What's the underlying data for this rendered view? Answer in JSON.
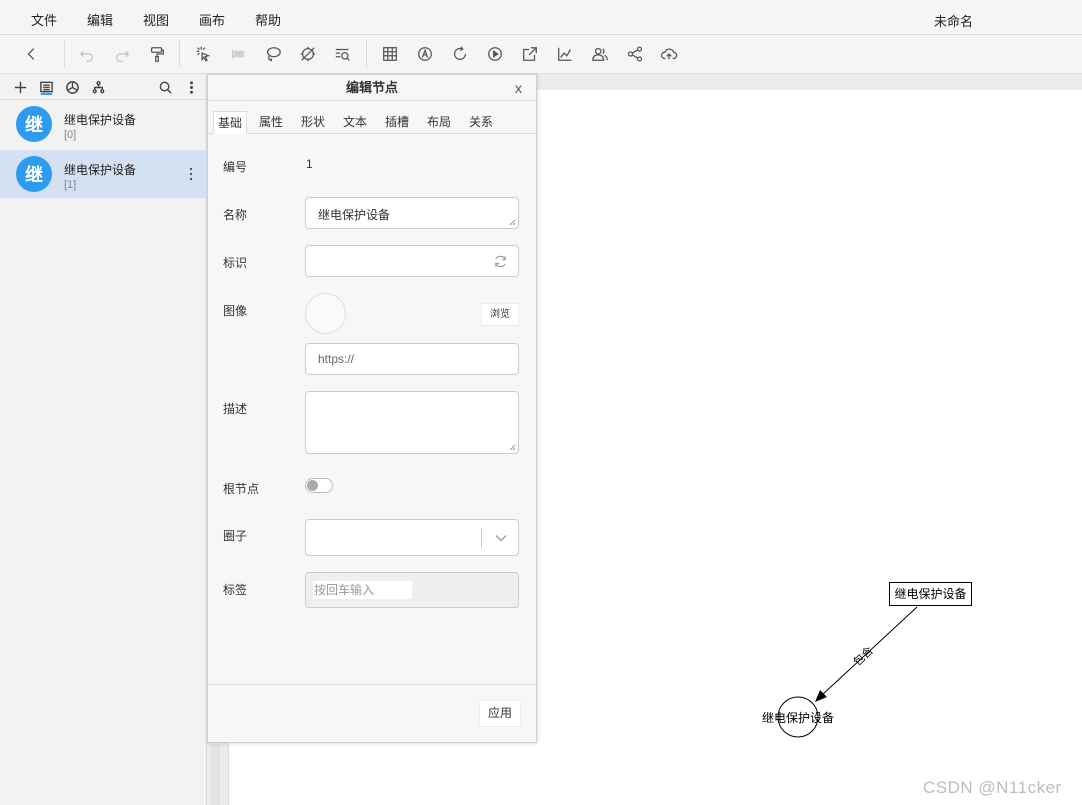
{
  "menubar": {
    "items": [
      "文件",
      "编辑",
      "视图",
      "画布",
      "帮助"
    ],
    "document_title": "未命名"
  },
  "toolbar": {
    "icons": [
      "back-icon",
      "undo-icon",
      "redo-icon",
      "format-painter-icon",
      "pointer-select-icon",
      "line-tool-icon",
      "lasso-icon",
      "clear-icon",
      "search-zoom-icon",
      "table-icon",
      "auto-layout-icon",
      "refresh-icon",
      "play-icon",
      "export-icon",
      "chart-icon",
      "users-icon",
      "share-icon",
      "cloud-upload-icon"
    ]
  },
  "sidebar": {
    "items": [
      {
        "avatar": "继",
        "name": "继电保护设备",
        "index": "[0]"
      },
      {
        "avatar": "继",
        "name": "继电保护设备",
        "index": "[1]"
      }
    ]
  },
  "dialog": {
    "title": "编辑节点",
    "close": "x",
    "tabs": [
      "基础",
      "属性",
      "形状",
      "文本",
      "插槽",
      "布局",
      "关系"
    ],
    "fields": {
      "id_label": "编号",
      "id_value": "1",
      "name_label": "名称",
      "name_value": "继电保护设备",
      "ident_label": "标识",
      "image_label": "图像",
      "browse_label": "浏览",
      "image_url_placeholder": "https://",
      "desc_label": "描述",
      "root_label": "根节点",
      "circle_label": "圈子",
      "tags_label": "标签",
      "tags_placeholder": "按回车输入"
    },
    "apply_label": "应用"
  },
  "diagram": {
    "source_node": "继电保护设备",
    "target_node": "继电保护设备",
    "edge_label": "包含"
  },
  "watermark": "CSDN @N11cker"
}
